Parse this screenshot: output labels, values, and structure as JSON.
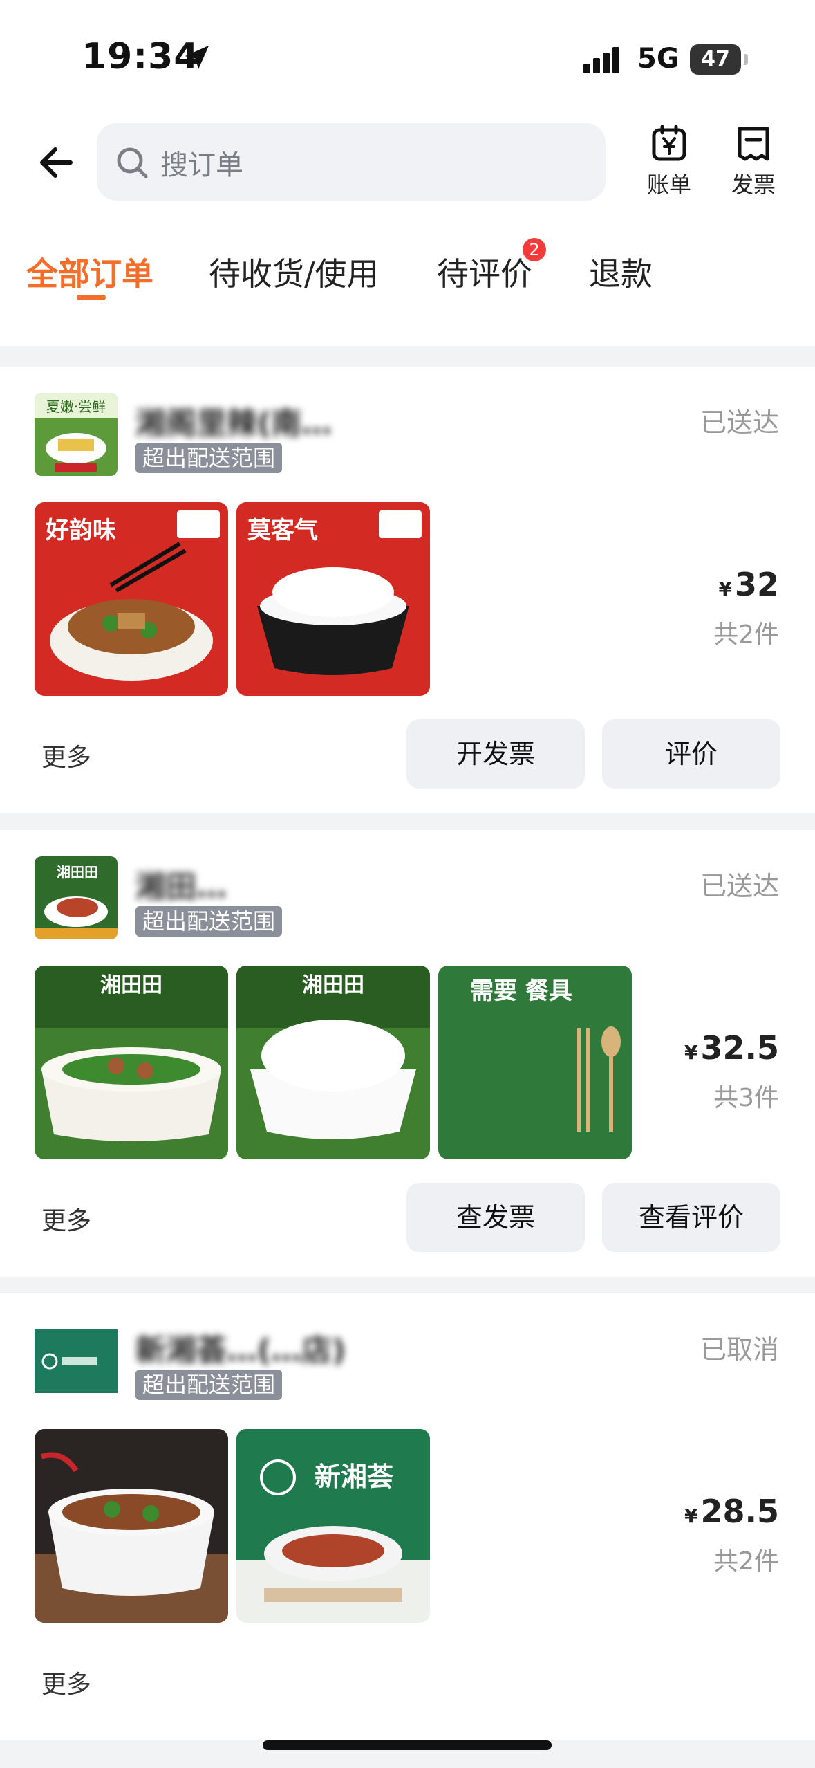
{
  "status_bar": {
    "time": "19:34",
    "network": "5G",
    "battery": "47"
  },
  "header": {
    "search_placeholder": "搜订单",
    "bill_label": "账单",
    "invoice_label": "发票"
  },
  "tabs": [
    {
      "label": "全部订单",
      "active": true
    },
    {
      "label": "待收货/使用",
      "active": false
    },
    {
      "label": "待评价",
      "active": false,
      "badge": "2"
    },
    {
      "label": "退款",
      "active": false
    }
  ],
  "orders": [
    {
      "store_name": "湘阁里辣(南…",
      "tag": "超出配送范围",
      "status": "已送达",
      "price": "32",
      "currency": "¥",
      "count": "共2件",
      "more": "更多",
      "logo_text": "夏嫩·尝鲜",
      "item_texts": [
        "好韵味",
        "莫客气"
      ],
      "buttons": [
        "开发票",
        "评价"
      ]
    },
    {
      "store_name": "湘田…",
      "tag": "超出配送范围",
      "status": "已送达",
      "price": "32.5",
      "currency": "¥",
      "count": "共3件",
      "more": "更多",
      "logo_text": "湘田田",
      "item_texts": [
        "湘田田",
        "湘田田",
        "需要 餐具"
      ],
      "buttons": [
        "查发票",
        "查看评价"
      ]
    },
    {
      "store_name": "新湘荟…(…店)",
      "tag": "超出配送范围",
      "status": "已取消",
      "price": "28.5",
      "currency": "¥",
      "count": "共2件",
      "more": "更多",
      "item_texts": [
        "新湘荟"
      ],
      "buttons": []
    }
  ],
  "colors": {
    "accent": "#f26e2a",
    "badge": "#f23c3c",
    "tag_bg": "#8a8f99"
  }
}
